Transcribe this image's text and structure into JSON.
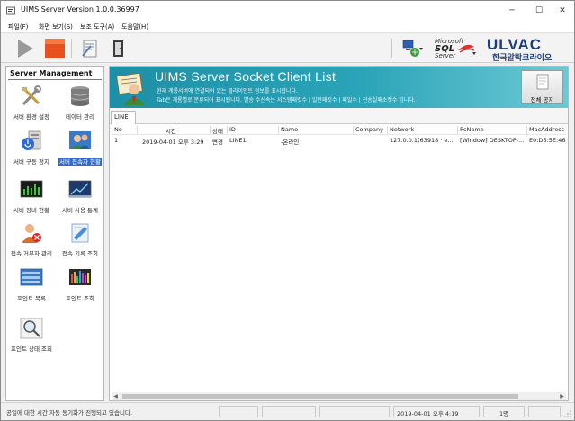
{
  "window": {
    "title": "UIMS Server Version 1.0.0.36997",
    "minimize_glyph": "─",
    "maximize_glyph": "☐",
    "close_glyph": "✕"
  },
  "menu": [
    "파일(F)",
    "화면 보기(S)",
    "보조 도구(A)",
    "도움말(H)"
  ],
  "toolbar": {
    "buttons": [
      "play-icon",
      "stop-icon",
      "config-icon",
      "door-icon"
    ],
    "sql_logo": {
      "line1": "Microsoft",
      "line2": "SQL",
      "line3": "Server"
    },
    "brand": {
      "name": "ULVAC",
      "subtitle": "한국알박크라이오"
    },
    "brand_color": "#1b3d7a"
  },
  "sidebar": {
    "title": "Server Management",
    "items": [
      {
        "label": "서버 환경 설정",
        "icon": "tools-icon"
      },
      {
        "label": "데이터 관리",
        "icon": "database-icon"
      },
      {
        "label": "서버 구동 정지",
        "icon": "server-power-icon"
      },
      {
        "label": "서버 접속자 현황",
        "icon": "users-icon",
        "selected": true
      },
      {
        "label": "서버 장비 현황",
        "icon": "equipment-monitor-icon"
      },
      {
        "label": "서버 사용 통계",
        "icon": "statistics-icon"
      },
      {
        "label": "접속 거부자 관리",
        "icon": "denied-user-icon"
      },
      {
        "label": "접속 기록 조회",
        "icon": "history-icon"
      },
      {
        "label": "포인트 목록",
        "icon": "point-list-icon"
      },
      {
        "label": "포인트 조회",
        "icon": "point-chart-icon"
      },
      {
        "label": "포인트 상태 조회",
        "icon": "magnifier-icon"
      }
    ],
    "selected_color": "#2f6cd0"
  },
  "main": {
    "banner_title": "UIMS Server Socket Client List",
    "banner_line1": "현재 계룡서버에 연결되어 있는 클라이언트 정보를 표시합니다.",
    "banner_line2": "Tab은 계룡별로 분류되어 표시됩니다. 발송 수신속는 서스템패킷수 | 일반패킷수 | 패일수 | 전송실패소켓수 입니다.",
    "notice_button": "전체 공지",
    "banner_color": "#2aa4b8",
    "tabs": [
      "LINE"
    ],
    "columns": [
      "No",
      "시간",
      "상태",
      "ID",
      "Name",
      "Company",
      "Network",
      "PcName",
      "MacAddress"
    ],
    "rows": [
      [
        "1",
        "2019-04-01 오후 3:29",
        "변경",
        "LINE1",
        "-온라인",
        "",
        "127.0.0.1(63918 · e...",
        "[Window] DESKTOP-...",
        "E0:D5:5E:46:2..."
      ]
    ]
  },
  "statusbar": {
    "message": "공일에 대한 시간 자동 동기화가 진행되고 있습니다.",
    "datetime": "2019-04-01 오후 4:19",
    "count": "1명"
  }
}
